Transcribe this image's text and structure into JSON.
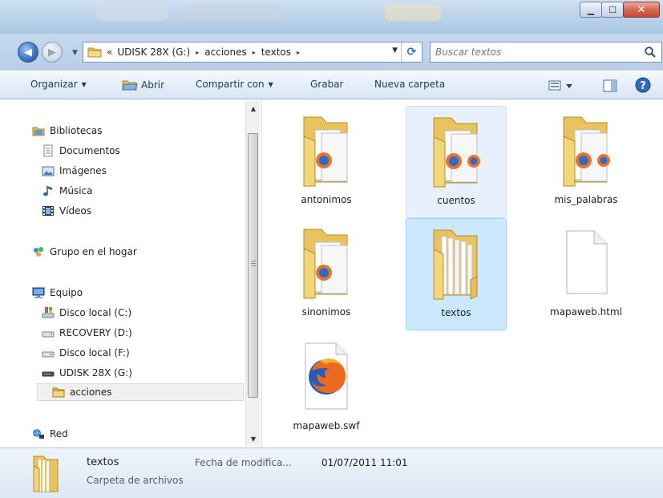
{
  "window": {
    "minimize_glyph": "▁",
    "maximize_glyph": "☐",
    "close_glyph": "✕"
  },
  "address": {
    "overflow": "«",
    "crumbs": [
      "UDISK 28X (G:)",
      "acciones",
      "textos"
    ],
    "separator": "▸",
    "refresh_glyph": "⟳"
  },
  "search": {
    "placeholder": "Buscar textos"
  },
  "commandbar": {
    "organize": "Organizar",
    "open": "Abrir",
    "share": "Compartir con",
    "burn": "Grabar",
    "new_folder": "Nueva carpeta"
  },
  "sidebar": {
    "libraries": "Bibliotecas",
    "library_items": [
      "Documentos",
      "Imágenes",
      "Música",
      "Vídeos"
    ],
    "homegroup": "Grupo en el hogar",
    "computer": "Equipo",
    "drives": [
      "Disco local (C:)",
      "RECOVERY (D:)",
      "Disco local (F:)",
      "UDISK 28X (G:)"
    ],
    "selected_folder": "acciones",
    "network": "Red"
  },
  "files": [
    {
      "name": "antonimos",
      "kind": "folder-ff",
      "state": "normal"
    },
    {
      "name": "cuentos",
      "kind": "folder-ff",
      "state": "hover"
    },
    {
      "name": "mis_palabras",
      "kind": "folder-ff",
      "state": "normal"
    },
    {
      "name": "sinonimos",
      "kind": "folder-ff",
      "state": "normal"
    },
    {
      "name": "textos",
      "kind": "folder-docs",
      "state": "selected"
    },
    {
      "name": "mapaweb.html",
      "kind": "blank-doc",
      "state": "normal"
    },
    {
      "name": "mapaweb.swf",
      "kind": "firefox-doc",
      "state": "normal"
    }
  ],
  "details": {
    "name": "textos",
    "type": "Carpeta de archivos",
    "modified_label": "Fecha de modifica...",
    "modified_value": "01/07/2011 11:01"
  },
  "colors": {
    "folder_yellow": "#f3d67a",
    "selection_blue": "#cce8ff",
    "link_blue": "#1e395b"
  }
}
